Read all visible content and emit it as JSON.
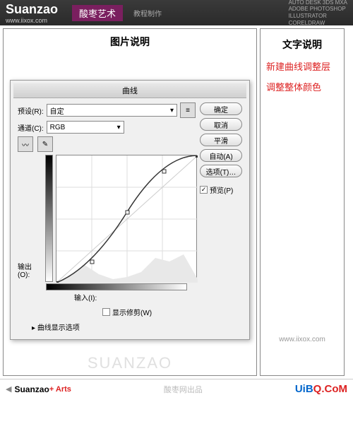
{
  "header": {
    "logo": "Suanzao",
    "url": "www.iixox.com",
    "art_title": "酸枣艺术",
    "tutorial": "教程制作",
    "apps": "AUTO DESK 3DS MXA\nADOBE PHOTOSHOP\nILLUSTRATOR\nCORELDRAW"
  },
  "leftTitle": "图片说明",
  "rightTitle": "文字说明",
  "rightText1": "新建曲线调整层",
  "rightText2": "调整整体颜色",
  "dialog": {
    "title": "曲线",
    "presetLabel": "预设(R):",
    "presetValue": "自定",
    "channelLabel": "通道(C):",
    "channelValue": "RGB",
    "outputLabel": "输出(O):",
    "inputLabel": "输入(I):",
    "showClipping": "显示修剪(W)",
    "displayOptions": "曲线显示选项",
    "ok": "确定",
    "cancel": "取消",
    "smooth": "平滑",
    "auto": "自动(A)",
    "options": "选项(T)…",
    "preview": "预览(P)"
  },
  "rightUrl": "www.iixox.com",
  "footer": {
    "brand": "Suanzao",
    "arts": "+ Arts",
    "mid": "酸枣网出品",
    "u": "UiB",
    "b": "Q.CoM"
  },
  "chart_data": {
    "type": "line",
    "title": "曲线 (Curves)",
    "xlabel": "输入",
    "ylabel": "输出",
    "xlim": [
      0,
      255
    ],
    "ylim": [
      0,
      255
    ],
    "series": [
      {
        "name": "RGB",
        "x": [
          0,
          60,
          128,
          195,
          255
        ],
        "y": [
          0,
          40,
          140,
          225,
          255
        ]
      }
    ],
    "histogram_hint": "background histogram visible, peaks in shadows and highlights"
  }
}
